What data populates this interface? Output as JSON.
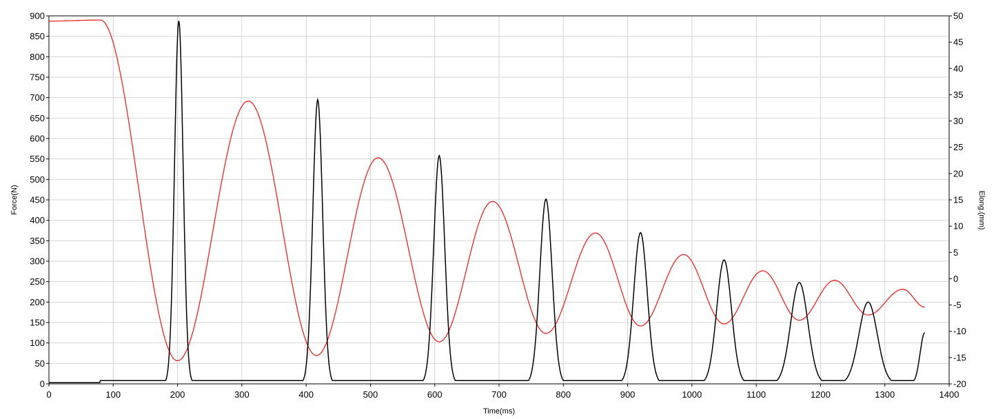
{
  "chart_data": {
    "type": "line",
    "xlabel": "Time(ms)",
    "ylabel_left": "Force(N)",
    "ylabel_right": "Elong.(mm)",
    "xlim": [
      0,
      1400
    ],
    "ylim_left": [
      0,
      900
    ],
    "ylim_right": [
      -20,
      50
    ],
    "x_ticks": [
      "0",
      "100",
      "200",
      "300",
      "400",
      "500",
      "600",
      "700",
      "800",
      "900",
      "1000",
      "1100",
      "1200",
      "1300",
      "1400"
    ],
    "y_left_ticks": [
      "0",
      "50",
      "100",
      "150",
      "200",
      "250",
      "300",
      "350",
      "400",
      "450",
      "500",
      "550",
      "600",
      "650",
      "700",
      "750",
      "800",
      "850",
      "900"
    ],
    "y_right_ticks": [
      "-20",
      "-15",
      "-10",
      "-5",
      "0",
      "5",
      "10",
      "15",
      "20",
      "25",
      "30",
      "35",
      "40",
      "45",
      "50"
    ],
    "grid": true,
    "series": [
      {
        "axis": "left",
        "color": "#000000",
        "baseline": 8,
        "peaks": [
          {
            "t": 202,
            "v": 888,
            "w": 14
          },
          {
            "t": 418,
            "v": 695,
            "w": 16
          },
          {
            "t": 607,
            "v": 558,
            "w": 18
          },
          {
            "t": 773,
            "v": 452,
            "w": 20
          },
          {
            "t": 920,
            "v": 370,
            "w": 22
          },
          {
            "t": 1050,
            "v": 303,
            "w": 24
          },
          {
            "t": 1167,
            "v": 248,
            "w": 28
          },
          {
            "t": 1274,
            "v": 200,
            "w": 30
          }
        ],
        "end": {
          "t": 1362,
          "v": 125
        }
      },
      {
        "axis": "right",
        "color": "#e8251f",
        "points": [
          [
            0,
            49.0
          ],
          [
            80,
            49.2
          ],
          [
            200,
            -15.6
          ],
          [
            310,
            33.8
          ],
          [
            416,
            -14.6
          ],
          [
            512,
            23.0
          ],
          [
            607,
            -12.0
          ],
          [
            690,
            14.7
          ],
          [
            773,
            -10.4
          ],
          [
            850,
            8.7
          ],
          [
            920,
            -9.0
          ],
          [
            987,
            4.6
          ],
          [
            1050,
            -8.6
          ],
          [
            1110,
            1.5
          ],
          [
            1167,
            -7.9
          ],
          [
            1222,
            -0.3
          ],
          [
            1274,
            -6.9
          ],
          [
            1328,
            -2.0
          ],
          [
            1362,
            -5.4
          ]
        ]
      }
    ]
  }
}
